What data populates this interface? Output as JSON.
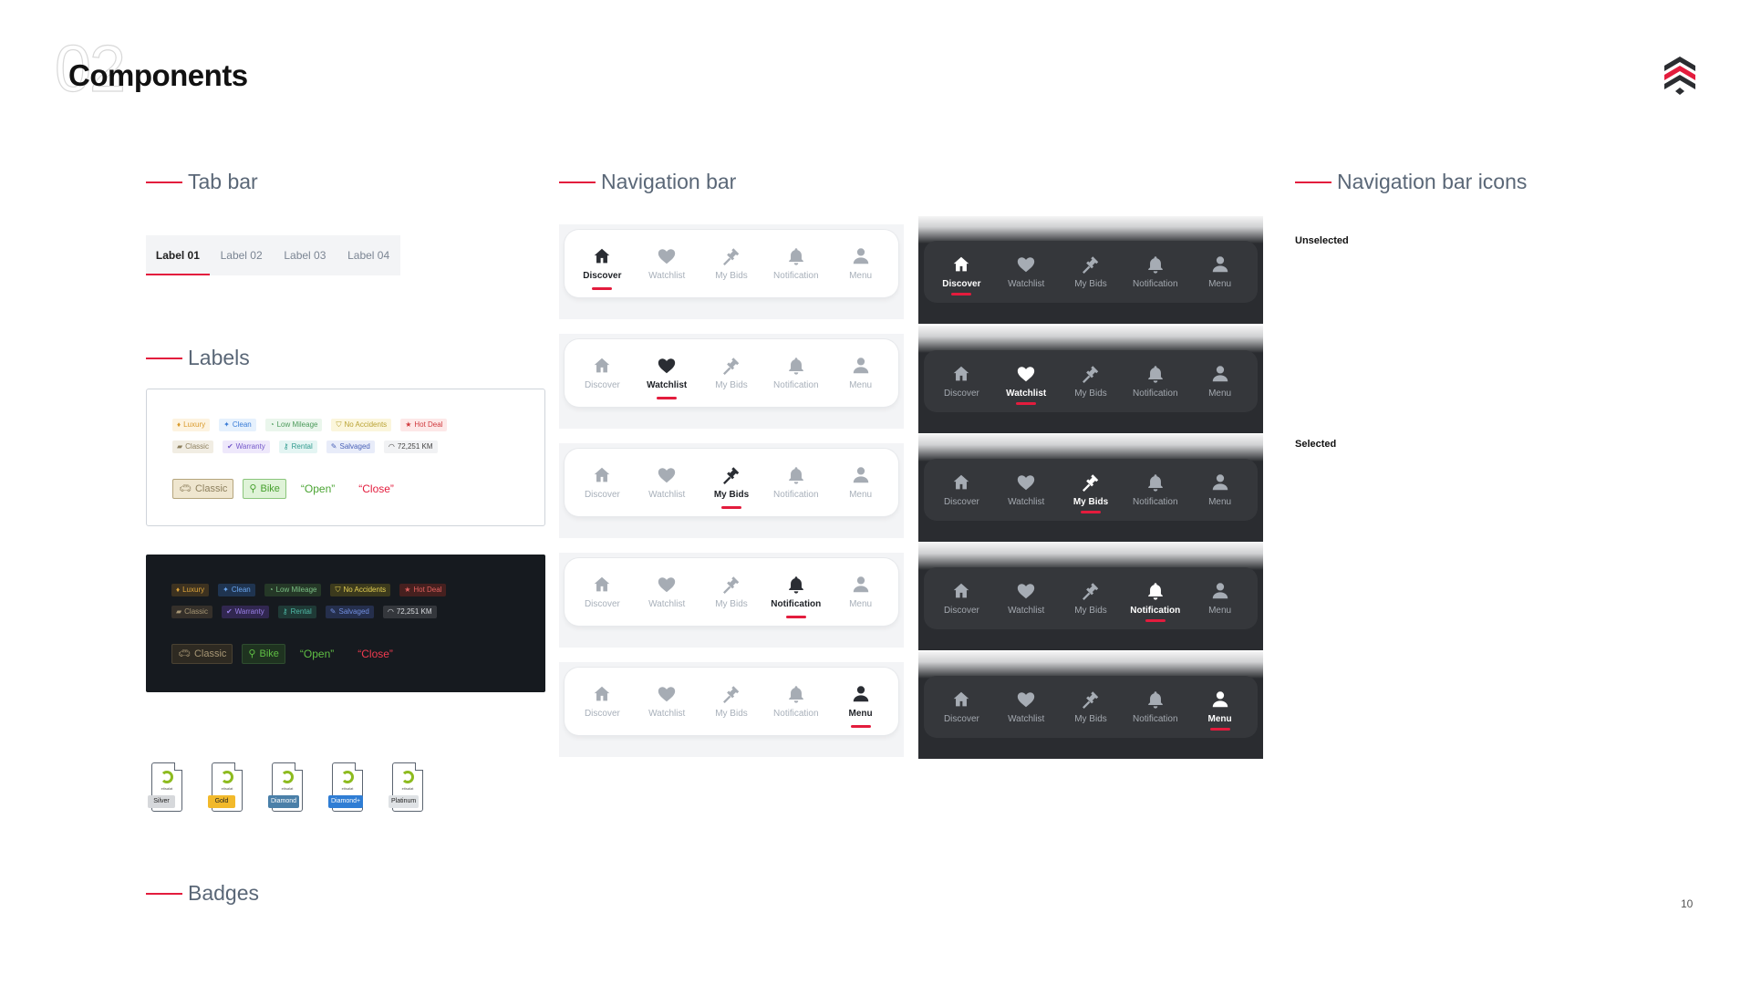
{
  "header": {
    "page_ghost_number": "02",
    "title": "Components",
    "page_number": "10"
  },
  "sections": {
    "tab_bar": "Tab bar",
    "labels": "Labels",
    "badges": "Badges",
    "navigation_bar": "Navigation bar",
    "navigation_bar_icons": "Navigation bar icons"
  },
  "tab_bar": {
    "tabs": [
      "Label 01",
      "Label 02",
      "Label 03",
      "Label 04"
    ],
    "active_index": 0
  },
  "labels": {
    "row1": [
      {
        "icon": "diamond-icon",
        "text": "Luxury"
      },
      {
        "icon": "sparkle-icon",
        "text": "Clean"
      },
      {
        "icon": "speedometer-icon",
        "text": "Low Mileage"
      },
      {
        "icon": "shield-icon",
        "text": "No Accidents"
      },
      {
        "icon": "star-icon",
        "text": "Hot Deal"
      }
    ],
    "row2": [
      {
        "icon": "car-icon",
        "text": "Classic"
      },
      {
        "icon": "check-badge-icon",
        "text": "Warranty"
      },
      {
        "icon": "key-icon",
        "text": "Rental"
      },
      {
        "icon": "wrench-icon",
        "text": "Salvaged"
      },
      {
        "icon": "gauge-icon",
        "text": "72,251 KM"
      }
    ],
    "row3": {
      "classic": "Classic",
      "bike": "Bike",
      "open": "“Open”",
      "close": "“Close”"
    }
  },
  "badges": [
    {
      "brand": "etisalat",
      "tier": "Silver",
      "color": "#d6d8db"
    },
    {
      "brand": "etisalat",
      "tier": "Gold",
      "color": "#f2b92b"
    },
    {
      "brand": "etisalat",
      "tier": "Diamond",
      "color": "#4a7fa8"
    },
    {
      "brand": "etisalat",
      "tier": "Diamond+",
      "color": "#2f7dd4"
    },
    {
      "brand": "etisalat",
      "tier": "Platinum",
      "color": "#dfe2e5"
    }
  ],
  "navigation": {
    "items": [
      {
        "label": "Discover",
        "icon": "home-icon"
      },
      {
        "label": "Watchlist",
        "icon": "heart-icon"
      },
      {
        "label": "My Bids",
        "icon": "gavel-icon"
      },
      {
        "label": "Notification",
        "icon": "bell-icon"
      },
      {
        "label": "Menu",
        "icon": "user-icon"
      }
    ]
  },
  "navigation_icons": {
    "unselected": "Unselected",
    "selected": "Selected"
  },
  "colors": {
    "accent": "#e31c3d",
    "dark_panel": "#161a1f",
    "dark_nav": "#35373b"
  }
}
